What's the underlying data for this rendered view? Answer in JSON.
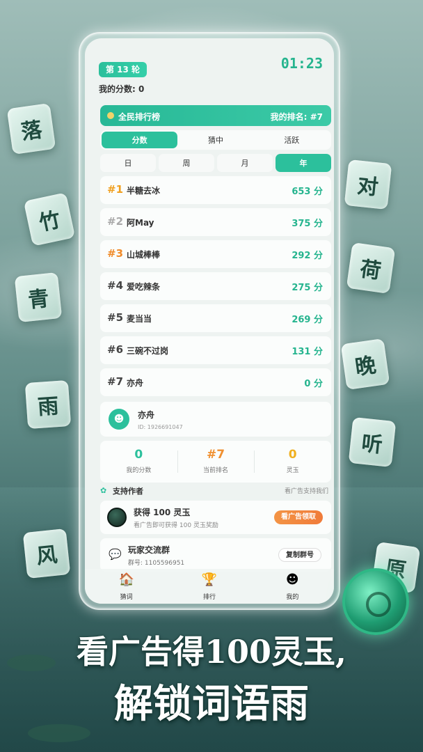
{
  "round_label": "第 13 轮",
  "timer": "01:23",
  "my_score_label": "我的分数: 0",
  "leaderboard": {
    "title": "全民排行榜",
    "my_rank": "我的排名: #7",
    "tabs": [
      {
        "label": "分数",
        "active": true
      },
      {
        "label": "猜中",
        "active": false
      },
      {
        "label": "活跃",
        "active": false
      }
    ],
    "periods": [
      {
        "label": "日",
        "active": false
      },
      {
        "label": "周",
        "active": false
      },
      {
        "label": "月",
        "active": false
      },
      {
        "label": "年",
        "active": true
      }
    ],
    "rows": [
      {
        "rank": "#1",
        "name": "半糖去冰",
        "score": "653 分"
      },
      {
        "rank": "#2",
        "name": "阿May",
        "score": "375 分"
      },
      {
        "rank": "#3",
        "name": "山城棒棒",
        "score": "292 分"
      },
      {
        "rank": "#4",
        "name": "爱吃辣条",
        "score": "275 分"
      },
      {
        "rank": "#5",
        "name": "麦当当",
        "score": "269 分"
      },
      {
        "rank": "#6",
        "name": "三碗不过岗",
        "score": "131 分"
      },
      {
        "rank": "#7",
        "name": "亦舟",
        "score": "0 分"
      }
    ]
  },
  "profile": {
    "name": "亦舟",
    "id": "ID: 1926691047",
    "stats": [
      {
        "value": "0",
        "label": "我的分数"
      },
      {
        "value": "#7",
        "label": "当前排名"
      },
      {
        "value": "0",
        "label": "灵玉"
      }
    ]
  },
  "support": {
    "title": "支持作者",
    "hint": "看广告支持我们",
    "ad": {
      "title": "获得 100 灵玉",
      "desc": "看广告即可获得 100 灵玉奖励",
      "button": "看广告领取"
    },
    "group": {
      "title": "玩家交流群",
      "number": "群号: 1105596951",
      "button": "复制群号"
    }
  },
  "nav": [
    {
      "label": "猜词",
      "icon": "house-icon"
    },
    {
      "label": "排行",
      "icon": "trophy-icon"
    },
    {
      "label": "我的",
      "icon": "avatar-icon"
    }
  ],
  "tiles": [
    "落",
    "竹",
    "青",
    "雨",
    "风",
    "对",
    "荷",
    "晚",
    "听",
    "原"
  ],
  "headline": {
    "line1": "看广告得100灵玉,",
    "line2": "解锁词语雨"
  },
  "colors": {
    "accent": "#2cc09c",
    "orange": "#f09030",
    "gold": "#f0b020"
  }
}
